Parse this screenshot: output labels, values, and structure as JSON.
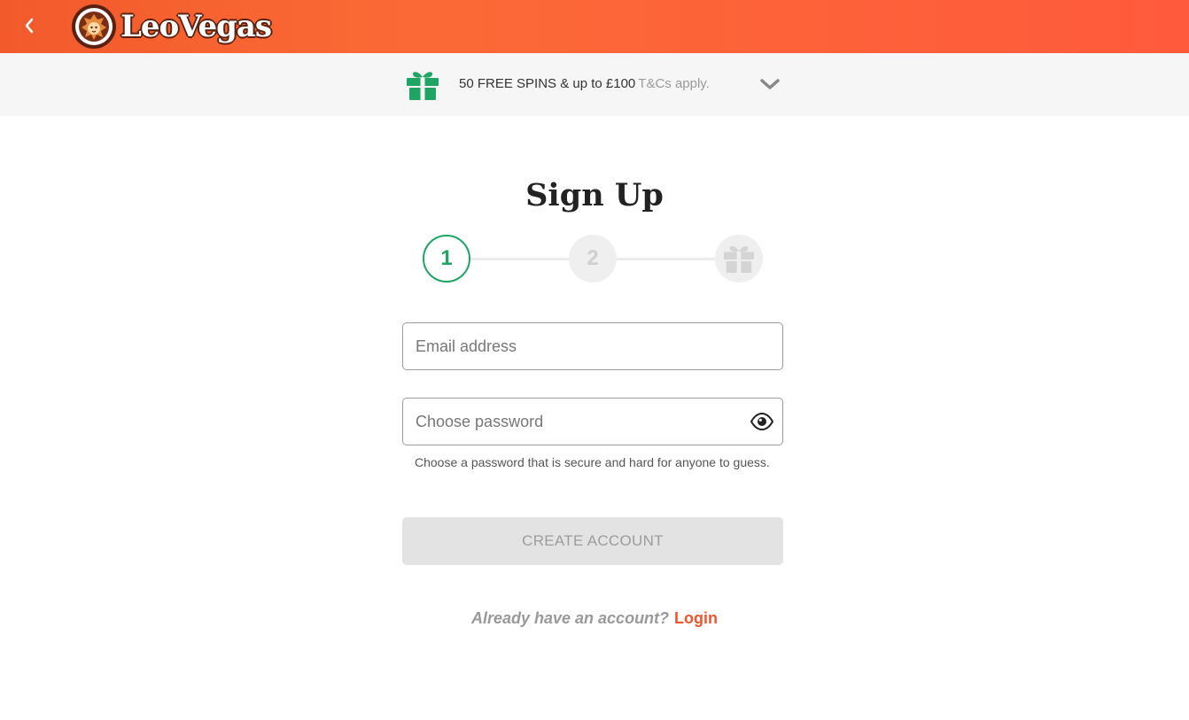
{
  "header": {
    "brand": "LeoVegas",
    "back_icon": "chevron-left-icon",
    "colors": {
      "gradient_start": "#f25a2b",
      "gradient_end": "#ff5a3c"
    }
  },
  "promo": {
    "icon": "gift-icon",
    "offer": "50 FREE SPINS & up to £100",
    "terms": "T&Cs apply.",
    "expand_icon": "chevron-down-icon"
  },
  "signup": {
    "title": "Sign Up",
    "steps": [
      {
        "label": "1",
        "state": "active"
      },
      {
        "label": "2",
        "state": "inactive"
      },
      {
        "icon": "gift-icon",
        "state": "inactive"
      }
    ],
    "email": {
      "placeholder": "Email address",
      "value": ""
    },
    "password": {
      "placeholder": "Choose password",
      "value": "",
      "toggle_icon": "eye-icon"
    },
    "password_hint": "Choose a password that is secure and hard for anyone to guess.",
    "submit_label": "CREATE ACCOUNT",
    "submit_enabled": false,
    "login_prompt": "Already have an account?",
    "login_label": "Login"
  },
  "colors": {
    "accent": "#f2542d",
    "step_active": "#1fa463",
    "gift_green": "#1fa463",
    "disabled_bg": "#e3e3e3"
  }
}
